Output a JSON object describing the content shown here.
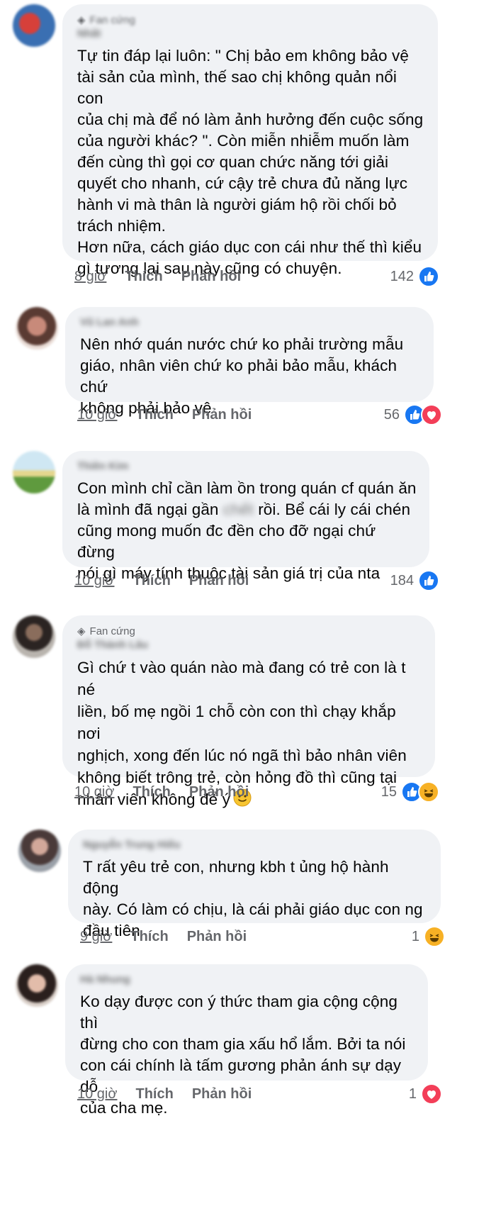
{
  "comments": [
    {
      "badge": "Fan cứng",
      "name": "Nhất",
      "text": "Tự tin đáp lại luôn: \" Chị bảo em không bảo vệ\ntài sản của mình, thế sao chị không quản nổi con\ncủa chị mà để nó làm ảnh hưởng đến cuộc sống\ncủa người khác? \". Còn miễn nhiễm muốn làm\nđến cùng thì gọi cơ quan chức năng tới giải\nquyết cho nhanh, cứ cậy trẻ chưa đủ năng lực\nhành vi mà thân là người giám hộ rồi chối bỏ\ntrách nhiệm.\nHơn nữa, cách giáo dục con cái như thế thì kiểu\ngì tương lai sau này cũng có chuyện.",
      "time": "8 giờ",
      "like_label": "Thích",
      "reply_label": "Phản hồi",
      "reaction_count": "142",
      "reactions": [
        "like"
      ]
    },
    {
      "name": "Vũ Lan Anh",
      "text": "Nên nhớ quán nước chứ ko phải trường mẫu\ngiáo, nhân viên chứ ko phải bảo mẫu, khách chứ\nkhông phải bảo vệ",
      "time": "10 giờ",
      "like_label": "Thích",
      "reply_label": "Phản hồi",
      "reaction_count": "56",
      "reactions": [
        "like",
        "love"
      ]
    },
    {
      "name": "Thiên Kim",
      "text_a": "Con mình chỉ cần làm ồn trong quán cf quán ăn\nlà mình đã ngại gần ",
      "hidden_word": "chết",
      "text_b": " rồi. Bể cái ly cái chén\ncũng mong muốn đc đền cho đỡ ngại chứ đừng\nnói gì máy tính thuộc tài sản giá trị của nta",
      "time": "10 giờ",
      "like_label": "Thích",
      "reply_label": "Phản hồi",
      "reaction_count": "184",
      "reactions": [
        "like"
      ]
    },
    {
      "badge": "Fan cứng",
      "name": "Đỗ Thành Lâu",
      "text": "Gì chứ t vào quán nào mà đang có trẻ con là t né\nliền, bố mẹ ngồi 1 chỗ còn con thì chạy khắp nơi\nnghịch, xong đến lúc nó ngã thì bảo nhân viên\nkhông biết trông trẻ, còn hỏng đồ thì cũng tại\nnhân viên không để ý",
      "time": "10 giờ",
      "like_label": "Thích",
      "reply_label": "Phản hồi",
      "reaction_count": "15",
      "reactions": [
        "like",
        "haha"
      ]
    },
    {
      "name": "Nguyễn Trung Hiếu",
      "text": "T rất yêu trẻ con, nhưng kbh t ủng hộ hành động\nnày. Có làm có chịu, là cái phải giáo dục con ng\nđầu tiên",
      "time": "9 giờ",
      "like_label": "Thích",
      "reply_label": "Phản hồi",
      "reaction_count": "1",
      "reactions": [
        "haha"
      ]
    },
    {
      "name": "Hà Nhung",
      "text": "Ko dạy được con ý thức tham gia cộng cộng thì\nđừng cho con tham gia xấu hổ lắm. Bởi ta nói\ncon cái chính là tấm gương phản ánh sự dạy dỗ\ncủa cha mẹ.",
      "time": "10 giờ",
      "like_label": "Thích",
      "reply_label": "Phản hồi",
      "reaction_count": "1",
      "reactions": [
        "love"
      ]
    }
  ],
  "colors": {
    "bubble": "#f0f2f5",
    "meta": "#65676b",
    "text": "#050505",
    "like": "#1877f2",
    "love": "#f33e58",
    "haha": "#f7b125"
  }
}
